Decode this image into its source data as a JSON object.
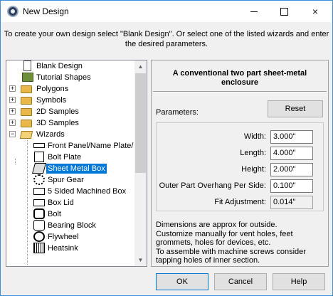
{
  "window": {
    "title": "New Design"
  },
  "titlebar": {
    "minimize": "minimize",
    "maximize": "maximize",
    "close": "×"
  },
  "intro": {
    "line1": "To create your own design select \"Blank Design\". Or select one of the listed wizards and enter",
    "line2": "the desired parameters."
  },
  "tree": {
    "items": [
      {
        "label": "Blank Design",
        "icon": "document-icon"
      },
      {
        "label": "Tutorial Shapes",
        "icon": "book-icon"
      },
      {
        "label": "Polygons",
        "icon": "folder-icon",
        "expander": "+"
      },
      {
        "label": "Symbols",
        "icon": "folder-icon",
        "expander": "+"
      },
      {
        "label": "2D Samples",
        "icon": "folder-icon",
        "expander": "+"
      },
      {
        "label": "3D Samples",
        "icon": "folder-icon",
        "expander": "+"
      },
      {
        "label": "Wizards",
        "icon": "folder-open-icon",
        "expander": "−"
      },
      {
        "label": "Front Panel/Name Plate/",
        "icon": "front-panel-icon"
      },
      {
        "label": "Bolt Plate",
        "icon": "bolt-plate-icon"
      },
      {
        "label": "Sheet Metal Box",
        "icon": "sheet-metal-box-icon",
        "selected": true
      },
      {
        "label": "Spur Gear",
        "icon": "spur-gear-icon"
      },
      {
        "label": "5 Sided Machined Box",
        "icon": "machined-box-icon"
      },
      {
        "label": "Box Lid",
        "icon": "box-lid-icon"
      },
      {
        "label": "Bolt",
        "icon": "bolt-icon"
      },
      {
        "label": "Bearing Block",
        "icon": "bearing-block-icon"
      },
      {
        "label": "Flywheel",
        "icon": "flywheel-icon"
      },
      {
        "label": "Heatsink",
        "icon": "heatsink-icon"
      }
    ]
  },
  "panel": {
    "title_line1": "A conventional two part sheet-metal",
    "title_line2": "enclosure",
    "params_label": "Parameters:",
    "reset_label": "Reset",
    "fields": [
      {
        "label": "Width:",
        "value": "3.000\""
      },
      {
        "label": "Length:",
        "value": "4.000\""
      },
      {
        "label": "Height:",
        "value": "2.000\""
      },
      {
        "label": "Outer Part Overhang Per Side:",
        "value": "0.100\""
      },
      {
        "label": "Fit Adjustment:",
        "value": "0.014\""
      }
    ],
    "notes": [
      "Dimensions are approx for outside.",
      "Customize manually for vent holes, feet",
      "grommets, holes for devices, etc.",
      "To assemble with machine screws consider",
      "tapping holes of inner section."
    ]
  },
  "footer": {
    "ok": "OK",
    "cancel": "Cancel",
    "help": "Help"
  }
}
